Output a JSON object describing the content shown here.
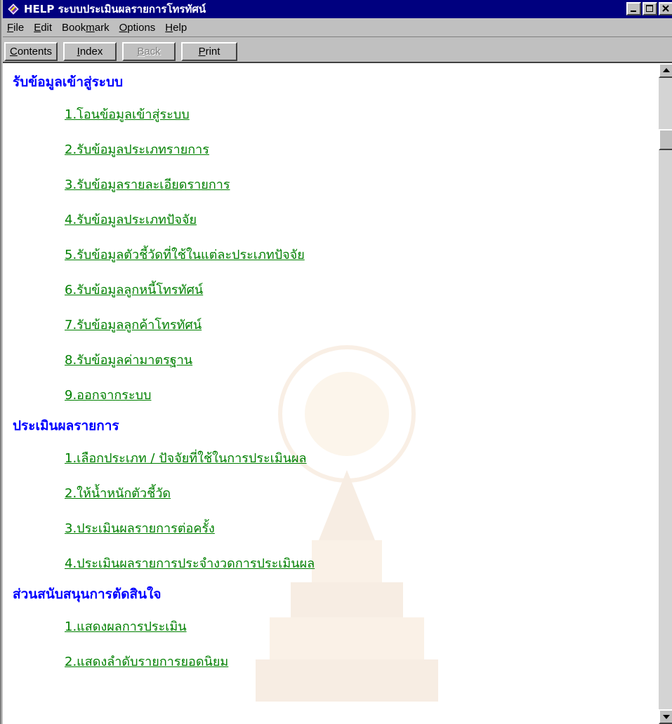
{
  "window": {
    "title": "HELP ระบบประเมินผลรายการโทรทัศน์",
    "controls": {
      "minimize": "minimize",
      "maximize": "maximize",
      "close": "close"
    }
  },
  "menu": [
    {
      "label": "File",
      "accel": "F",
      "rest": "ile"
    },
    {
      "label": "Edit",
      "accel": "E",
      "rest": "dit"
    },
    {
      "label": "Bookmark",
      "pre": "Book",
      "accel": "m",
      "rest": "ark"
    },
    {
      "label": "Options",
      "accel": "O",
      "rest": "ptions"
    },
    {
      "label": "Help",
      "accel": "H",
      "rest": "elp"
    }
  ],
  "toolbar": {
    "contents": {
      "accel": "C",
      "rest": "ontents"
    },
    "index": {
      "accel": "I",
      "rest": "ndex"
    },
    "back": {
      "accel": "B",
      "rest": "ack"
    },
    "print": {
      "accel": "P",
      "rest": "rint"
    }
  },
  "sections": [
    {
      "title": "รับข้อมูลเข้าสู่ระบบ",
      "links": [
        "1.โอนข้อมูลเข้าสู่ระบบ",
        "2.รับข้อมูลประเภทรายการ",
        "3.รับข้อมูลรายละเอียดรายการ",
        "4.รับข้อมูลประเภทปัจจัย",
        "5.รับข้อมูลตัวชี้วัดที่ใช้ในแต่ละประเภทปัจจัย",
        "6.รับข้อมูลลูกหนี้โทรทัศน์",
        "7.รับข้อมูลลูกค้าโทรทัศน์",
        "8.รับข้อมูลค่ามาตรฐาน",
        "9.ออกจากระบบ"
      ]
    },
    {
      "title": "ประเมินผลรายการ",
      "links": [
        "1.เลือกประเภท / ปัจจัยที่ใช้ในการประเมินผล",
        "2.ให้น้ำหนักตัวชี้วัด",
        "3.ประเมินผลรายการต่อครั้ง",
        "4.ประเมินผลรายการประจำงวดการประเมินผล"
      ]
    },
    {
      "title": "ส่วนสนับสนุนการตัดสินใจ",
      "links": [
        "1.แสดงผลการประเมิน",
        "2.แสดงลำดับรายการยอดนิยม"
      ]
    }
  ],
  "colors": {
    "title_bar": "#00007f",
    "section_heading": "#0000ff",
    "link": "#008000",
    "chrome": "#c0c0c0"
  }
}
